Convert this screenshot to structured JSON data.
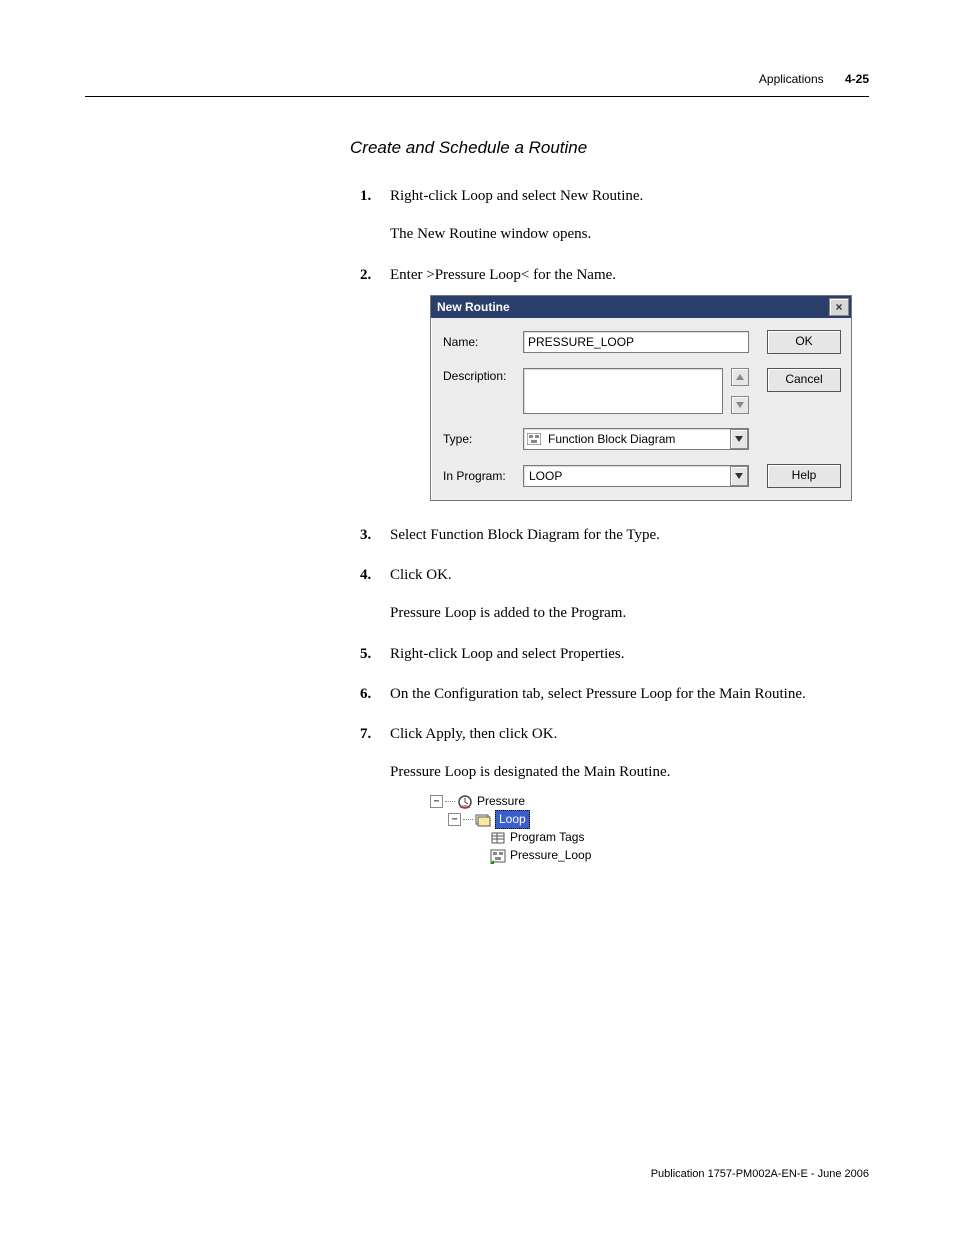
{
  "header": {
    "chapter": "Applications",
    "page": "4-25"
  },
  "section_title": "Create and Schedule a Routine",
  "steps": {
    "s1": {
      "num": "1.",
      "text": "Right-click Loop and select New Routine.",
      "sub": "The New Routine window opens."
    },
    "s2": {
      "num": "2.",
      "text": "Enter >Pressure Loop< for the Name."
    },
    "s3": {
      "num": "3.",
      "text": "Select Function Block Diagram for the Type."
    },
    "s4": {
      "num": "4.",
      "text": "Click OK.",
      "sub": "Pressure Loop is added to the Program."
    },
    "s5": {
      "num": "5.",
      "text": "Right-click Loop and select Properties."
    },
    "s6": {
      "num": "6.",
      "text": "On the Configuration tab, select Pressure Loop for the Main Routine."
    },
    "s7": {
      "num": "7.",
      "text": "Click Apply, then click OK.",
      "sub": "Pressure Loop is designated the Main Routine."
    }
  },
  "dialog": {
    "title": "New Routine",
    "labels": {
      "name": "Name:",
      "description": "Description:",
      "type": "Type:",
      "in_program": "In Program:"
    },
    "values": {
      "name": "PRESSURE_LOOP",
      "description": "",
      "type": "Function Block Diagram",
      "in_program": "LOOP"
    },
    "buttons": {
      "ok": "OK",
      "cancel": "Cancel",
      "help": "Help"
    }
  },
  "tree": {
    "n1": "Pressure",
    "n2": "Loop",
    "n3": "Program Tags",
    "n4": "Pressure_Loop"
  },
  "footer": "Publication 1757-PM002A-EN-E - June 2006"
}
